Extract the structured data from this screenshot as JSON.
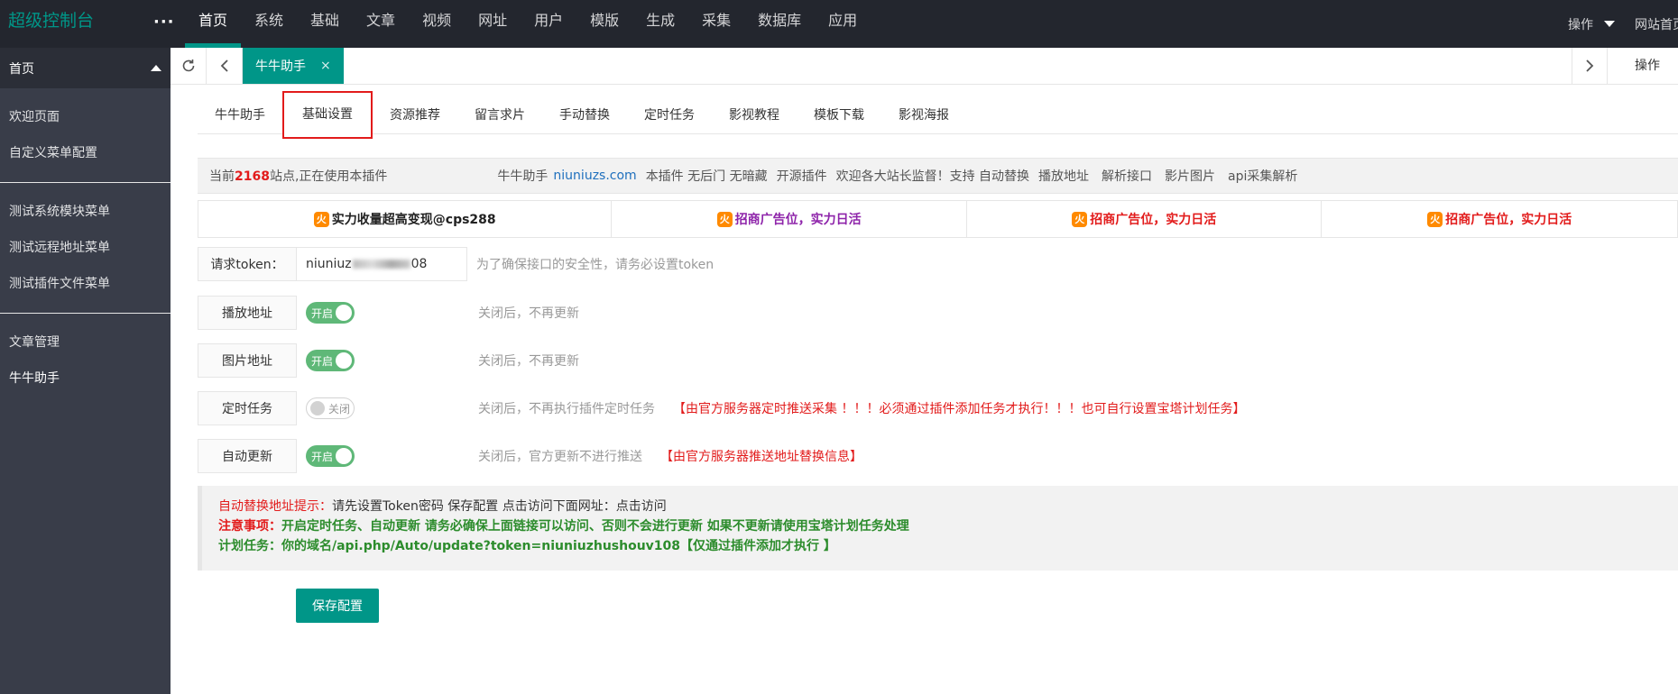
{
  "header": {
    "logo": "超级控制台",
    "more": "···",
    "nav": [
      "首页",
      "系统",
      "基础",
      "文章",
      "视频",
      "网址",
      "用户",
      "模版",
      "生成",
      "采集",
      "数据库",
      "应用"
    ],
    "ops_label": "操作",
    "home_label": "网站首页"
  },
  "sidebar": {
    "group": "首页",
    "items_a": [
      "欢迎页面",
      "自定义菜单配置"
    ],
    "items_b": [
      "测试系统模块菜单",
      "测试远程地址菜单",
      "测试插件文件菜单"
    ],
    "items_c": [
      "文章管理",
      "牛牛助手"
    ]
  },
  "tabbar": {
    "active_tab": "牛牛助手",
    "close": "×",
    "ops_label": "操作"
  },
  "subtabs": [
    "牛牛助手",
    "基础设置",
    "资源推荐",
    "留言求片",
    "手动替换",
    "定时任务",
    "影视教程",
    "模板下载",
    "影视海报"
  ],
  "infobar": {
    "prefix": "当前",
    "count": "2168",
    "suffix": "站点,正在使用本插件",
    "brand": "牛牛助手",
    "site": "niuniuzs.com",
    "tags": [
      "本插件 无后门 无暗藏",
      "开源插件",
      "欢迎各大站长监督！支持 自动替换",
      "播放地址",
      "解析接口",
      "影片图片",
      "api采集解析"
    ]
  },
  "ads": [
    {
      "text": "实力收量超高变现@cps288",
      "color": "#222222"
    },
    {
      "text": "招商广告位，实力日活",
      "color": "#8e24aa"
    },
    {
      "text": "招商广告位，实力日活",
      "color": "#e21b1b"
    },
    {
      "text": "招商广告位，实力日活",
      "color": "#e21b1b"
    }
  ],
  "form": {
    "token_label": "请求token：",
    "token_value_a": "niuniuz",
    "token_value_b": "08",
    "token_hint": "为了确保接口的安全性，请务必设置token",
    "on_label": "开启",
    "off_label": "关闭",
    "play_label": "播放地址",
    "play_hint": "关闭后，不再更新",
    "pic_label": "图片地址",
    "pic_hint": "关闭后，不再更新",
    "cron_label": "定时任务",
    "cron_hint": "关闭后，不再执行插件定时任务",
    "cron_warn": "【由官方服务器定时推送采集 ！！！必须通过插件添加任务才执行！！！也可自行设置宝塔计划任务】",
    "auto_label": "自动更新",
    "auto_hint": "关闭后，官方更新不进行推送",
    "auto_warn": "【由官方服务器推送地址替换信息】"
  },
  "notes": {
    "line1_red": "自动替换地址提示：",
    "line1_dark": "请先设置Token密码 保存配置 点击访问下面网址：点击访问",
    "line2_red": "注意事项：",
    "line2_green": "开启定时任务、自动更新 请务必确保上面链接可以访问、否则不会进行更新 如果不更新请使用宝塔计划任务处理",
    "line3_green": "计划任务：你的域名/api.php/Auto/update?token=niuniuzhushouv108",
    "line3_red": "【仅通过插件添加才执行 】"
  },
  "save_label": "保存配置"
}
